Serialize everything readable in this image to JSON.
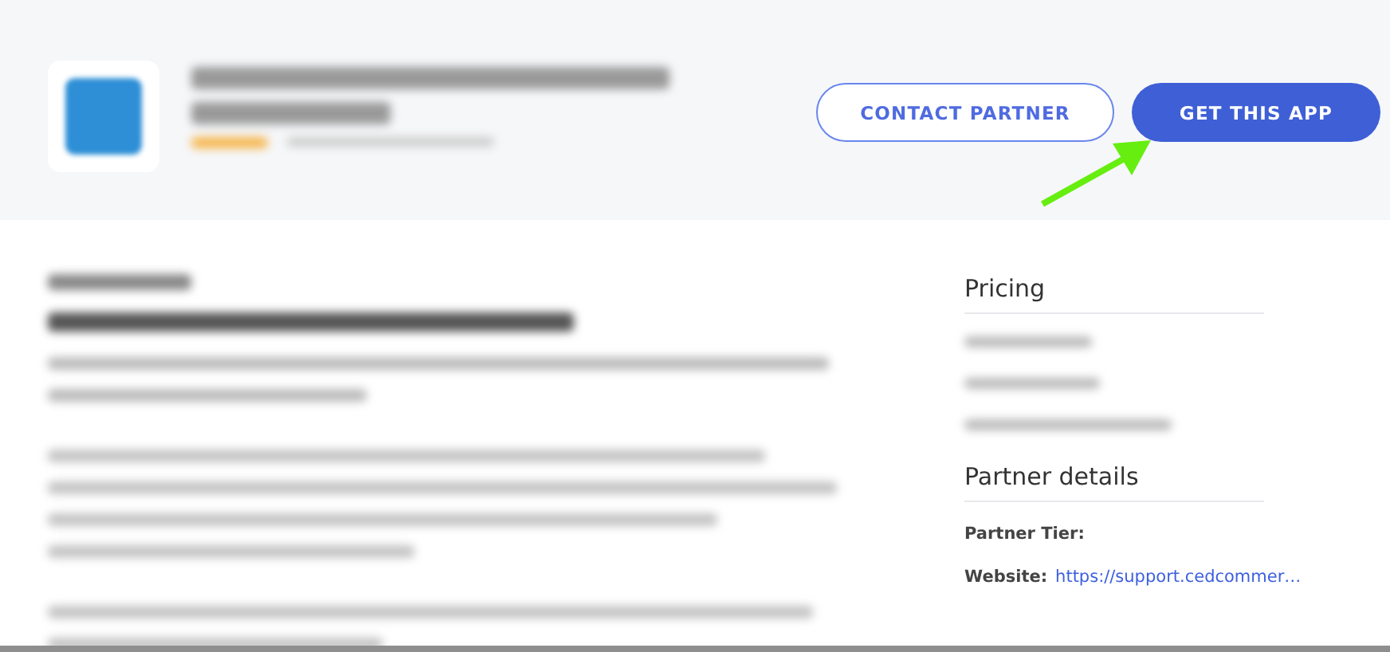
{
  "header": {
    "buttons": [
      {
        "label": "CONTACT PARTNER",
        "kind": "outline"
      },
      {
        "label": "GET THIS APP",
        "kind": "primary"
      }
    ]
  },
  "sidebar": {
    "sections": [
      {
        "title": "Pricing"
      },
      {
        "title": "Partner details",
        "fields": [
          {
            "label": "Partner Tier:"
          },
          {
            "label": "Website:",
            "value": "https://support.cedcommer…"
          }
        ]
      }
    ]
  }
}
